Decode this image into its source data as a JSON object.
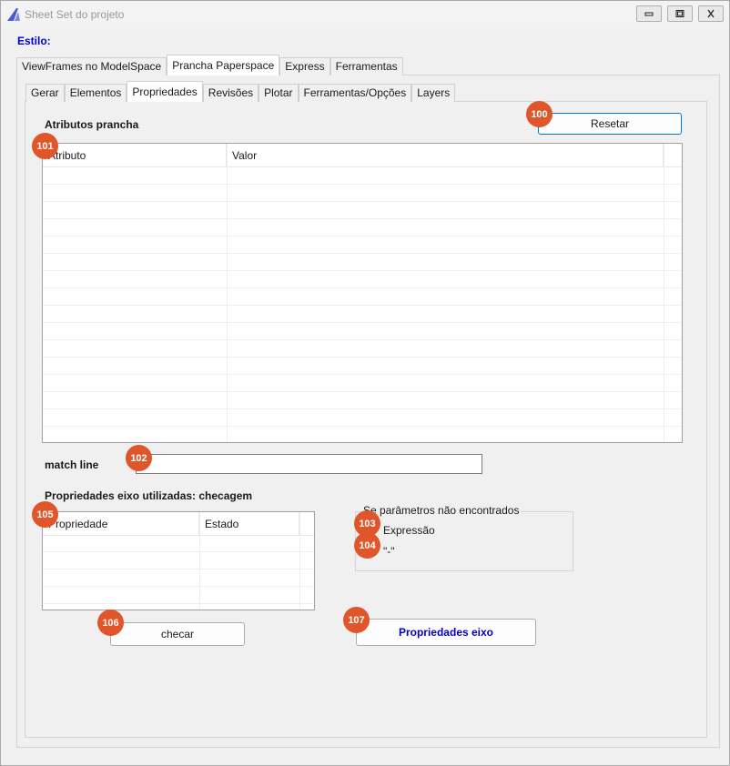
{
  "window": {
    "title": "Sheet Set do projeto"
  },
  "estilo_label": "Estilo:",
  "main_tabs": [
    "ViewFrames no ModelSpace",
    "Prancha Paperspace",
    "Express",
    "Ferramentas"
  ],
  "main_tab_active": "Prancha Paperspace",
  "sub_tabs": [
    "Gerar",
    "Elementos",
    "Propriedades",
    "Revisões",
    "Plotar",
    "Ferramentas/Opções",
    "Layers"
  ],
  "sub_tab_active": "Propriedades",
  "atributos": {
    "title": "Atributos prancha",
    "reset_button": "Resetar",
    "columns": [
      "Atributo",
      "Valor"
    ]
  },
  "match_line": {
    "label": "match line",
    "value": ""
  },
  "checagem": {
    "title": "Propriedades eixo utilizadas: checagem",
    "columns": [
      "Propriedade",
      "Estado"
    ],
    "check_button": "checar"
  },
  "not_found_group": {
    "legend": "Se parâmetros não encontrados",
    "option_expression": "Expressão",
    "option_dash": "\"-\""
  },
  "propriedades_eixo_button": "Propriedades eixo",
  "badges": [
    "100",
    "101",
    "102",
    "103",
    "104",
    "105",
    "106",
    "107"
  ],
  "colors": {
    "label_blue": "#0000cc",
    "badge": "#e0562a",
    "focus_border": "#0078d7"
  },
  "icons": [
    "app-icon",
    "minimize-icon",
    "maximize-icon",
    "close-icon"
  ]
}
